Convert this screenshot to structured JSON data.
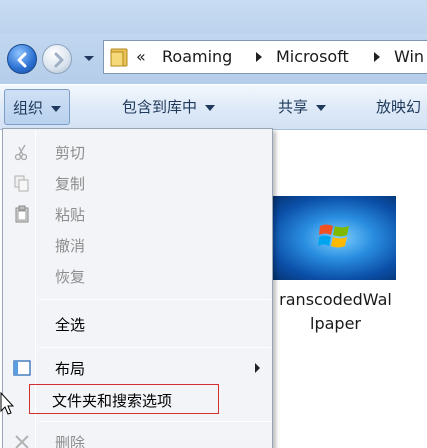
{
  "navigation": {
    "back_icon": "back-arrow-icon",
    "forward_icon": "forward-arrow-icon",
    "history_icon": "chevron-down-icon"
  },
  "address_bar": {
    "overflow": "«",
    "crumbs": [
      "Roaming",
      "Microsoft",
      "Win"
    ]
  },
  "toolbar": {
    "organize": "组织",
    "include_in_library": "包含到库中",
    "share": "共享",
    "slideshow": "放映幻"
  },
  "content": {
    "items": [
      {
        "name": "TranscodedWallpaper",
        "label_line1": "ranscodedWal",
        "label_line2": "lpaper"
      }
    ]
  },
  "menu": {
    "cut": "剪切",
    "copy": "复制",
    "paste": "粘贴",
    "undo": "撤消",
    "redo": "恢复",
    "select_all": "全选",
    "layout": "布局",
    "folder_search_options": "文件夹和搜索选项",
    "delete": "删除"
  },
  "colors": {
    "highlight_border": "#d23030",
    "toolbar_text": "#1e395b",
    "disabled_text": "#8d8d8d"
  }
}
